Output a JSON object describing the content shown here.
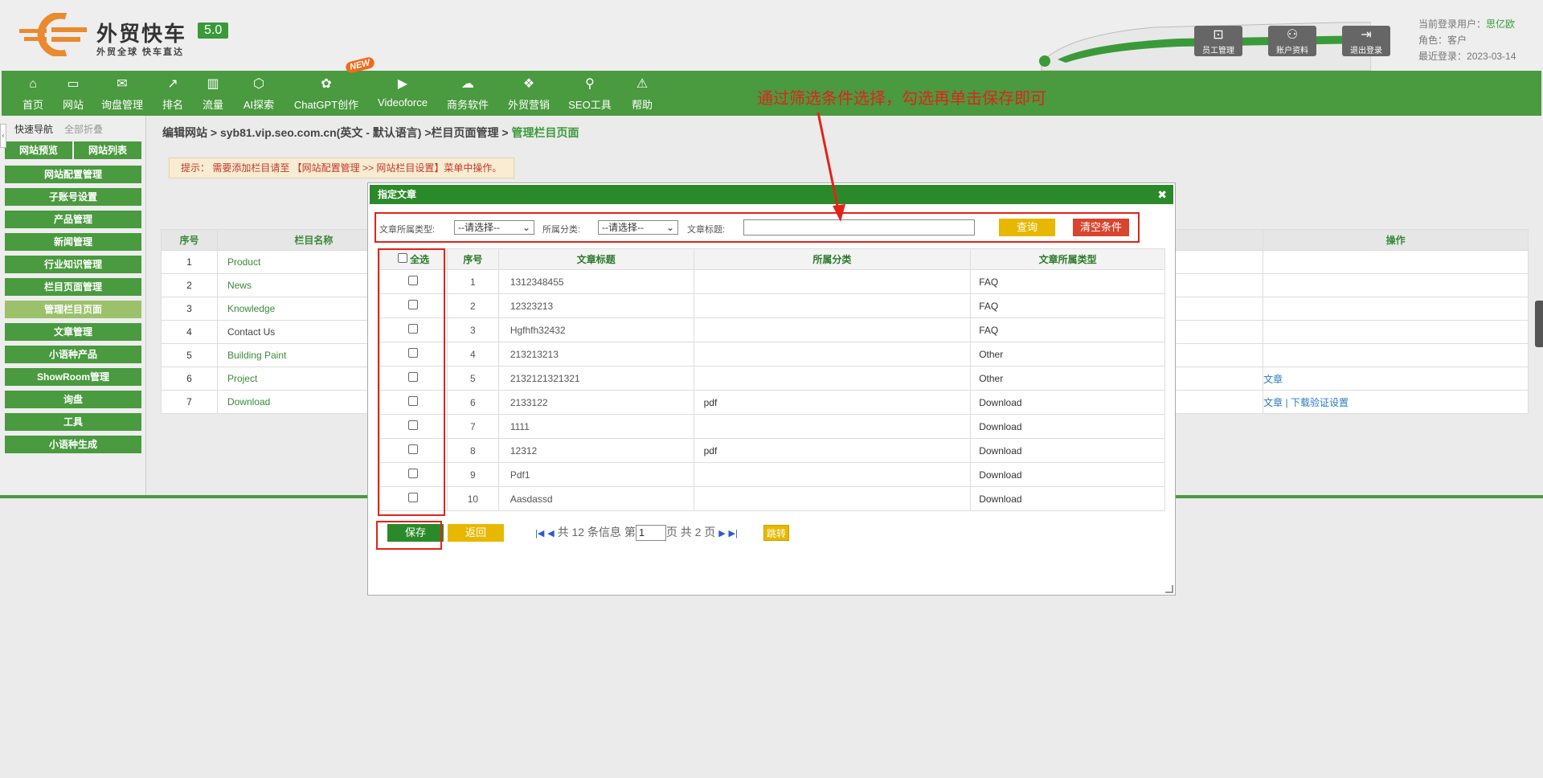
{
  "header": {
    "brand": "外贸快车",
    "version": "5.0",
    "slogan": "外贸全球 快车直达",
    "buttons": [
      {
        "label": "员工管理",
        "icon": "staff-icon"
      },
      {
        "label": "账户资料",
        "icon": "account-icon"
      },
      {
        "label": "退出登录",
        "icon": "logout-icon"
      }
    ],
    "user": {
      "current_user_label": "当前登录用户：",
      "current_user": "思亿欧",
      "role_label": "角色：",
      "role": "客户",
      "last_login_label": "最近登录：",
      "last_login": "2023-03-14"
    }
  },
  "nav": {
    "new_badge": "NEW",
    "items": [
      {
        "label": "首页",
        "icon": "home-icon"
      },
      {
        "label": "网站",
        "icon": "monitor-icon"
      },
      {
        "label": "询盘管理",
        "icon": "mail-icon"
      },
      {
        "label": "排名",
        "icon": "ranking-icon"
      },
      {
        "label": "流量",
        "icon": "chart-icon"
      },
      {
        "label": "AI探索",
        "icon": "ai-icon"
      },
      {
        "label": "ChatGPT创作",
        "icon": "chatgpt-icon"
      },
      {
        "label": "Videoforce",
        "icon": "video-icon"
      },
      {
        "label": "商务软件",
        "icon": "software-icon"
      },
      {
        "label": "外贸营销",
        "icon": "marketing-icon"
      },
      {
        "label": "SEO工具",
        "icon": "search-icon"
      },
      {
        "label": "帮助",
        "icon": "help-icon"
      }
    ]
  },
  "sidebar": {
    "quick_nav": "快速导航",
    "collapse_all": "全部折叠",
    "preview": "网站预览",
    "site_list": "网站列表",
    "items": [
      {
        "label": "网站配置管理",
        "active": false
      },
      {
        "label": "子账号设置",
        "active": false
      },
      {
        "label": "产品管理",
        "active": false
      },
      {
        "label": "新闻管理",
        "active": false
      },
      {
        "label": "行业知识管理",
        "active": false
      },
      {
        "label": "栏目页面管理",
        "active": false
      },
      {
        "label": "管理栏目页面",
        "active": true
      },
      {
        "label": "文章管理",
        "active": false
      },
      {
        "label": "小语种产品",
        "active": false
      },
      {
        "label": "ShowRoom管理",
        "active": false
      },
      {
        "label": "询盘",
        "active": false
      },
      {
        "label": "工具",
        "active": false
      },
      {
        "label": "小语种生成",
        "active": false
      }
    ]
  },
  "breadcrumb": {
    "path": "编辑网站 > syb81.vip.seo.com.cn(英文 - 默认语言) >栏目页面管理 > ",
    "current": "管理栏目页面"
  },
  "tip": "提示：  需要添加栏目请至 【网站配置管理 >> 网站栏目设置】菜单中操作。",
  "main_table": {
    "headers": [
      "序号",
      "栏目名称",
      "操作"
    ],
    "rows": [
      {
        "no": "1",
        "name": "Product",
        "ops": ""
      },
      {
        "no": "2",
        "name": "News",
        "ops": ""
      },
      {
        "no": "3",
        "name": "Knowledge",
        "ops": ""
      },
      {
        "no": "4",
        "name": "Contact Us",
        "ops": ""
      },
      {
        "no": "5",
        "name": "Building Paint",
        "ops": ""
      },
      {
        "no": "6",
        "name": "Project",
        "ops": "文章"
      },
      {
        "no": "7",
        "name": "Download",
        "ops": "文章  |  下载验证设置"
      }
    ]
  },
  "dialog": {
    "title": "指定文章",
    "filter": {
      "type_label": "文章所属类型:",
      "type_value": "--请选择--",
      "category_label": "所属分类:",
      "category_value": "--请选择--",
      "title_label": "文章标题:",
      "title_value": "",
      "query_button": "查询",
      "clear_button": "清空条件"
    },
    "table": {
      "select_all": "全选",
      "headers": [
        "序号",
        "文章标题",
        "所属分类",
        "文章所属类型"
      ],
      "rows": [
        {
          "no": "1",
          "title": "1312348455",
          "category": "",
          "type": "FAQ"
        },
        {
          "no": "2",
          "title": "12323213",
          "category": "",
          "type": "FAQ"
        },
        {
          "no": "3",
          "title": "Hgfhfh32432",
          "category": "",
          "type": "FAQ"
        },
        {
          "no": "4",
          "title": "213213213",
          "category": "",
          "type": "Other"
        },
        {
          "no": "5",
          "title": "2132121321321",
          "category": "",
          "type": "Other"
        },
        {
          "no": "6",
          "title": "2133122",
          "category": "pdf",
          "type": "Download"
        },
        {
          "no": "7",
          "title": "1111",
          "category": "",
          "type": "Download"
        },
        {
          "no": "8",
          "title": "12312",
          "category": "pdf",
          "type": "Download"
        },
        {
          "no": "9",
          "title": "Pdf1",
          "category": "",
          "type": "Download"
        },
        {
          "no": "10",
          "title": "Aasdassd",
          "category": "",
          "type": "Download"
        }
      ]
    },
    "save_button": "保存",
    "back_button": "返回",
    "pager": {
      "summary_pre": " 共 12 条信息 第",
      "page": "1",
      "summary_post": "页 共 2 页 ",
      "jump_button": "跳转"
    }
  },
  "annotation": {
    "text": "通过筛选条件选择，勾选再单击保存即可",
    "color": "#e2231a"
  }
}
